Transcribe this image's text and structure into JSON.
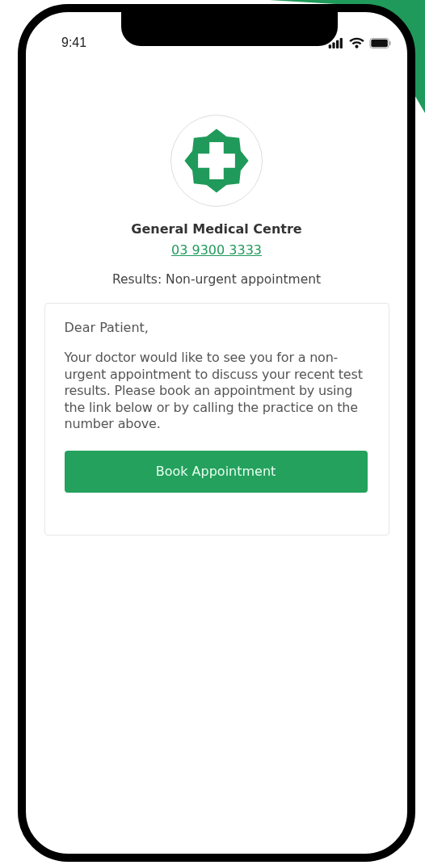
{
  "status_bar": {
    "time": "9:41"
  },
  "clinic": {
    "name": "General Medical Centre",
    "phone": "03 9300 3333"
  },
  "subject": "Results: Non-urgent appointment",
  "message": {
    "greeting": "Dear Patient,",
    "body": "Your doctor would like to see you for a non-urgent appointment to discuss your recent test results. Please book an appointment by using the link below or by calling the practice on the number above."
  },
  "button": {
    "label": "Book Appointment"
  }
}
